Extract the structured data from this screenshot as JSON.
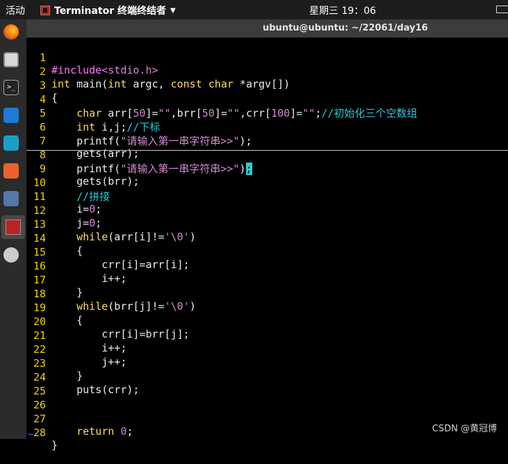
{
  "topbar": {
    "activities": "活动",
    "app_name": "Terminator 终端终结者",
    "clock": "星期三 19：06"
  },
  "window": {
    "title": "ubuntu@ubuntu: ~/22061/day16"
  },
  "dock": {
    "items": [
      "firefox-icon",
      "files-icon",
      "terminal-icon",
      "vscode-icon",
      "vscode-insiders-icon",
      "software-center-icon",
      "network-tool-icon",
      "terminator-icon",
      "update-icon"
    ]
  },
  "editor": {
    "filler": "~",
    "lines": [
      {
        "n": "1"
      },
      {
        "n": "2"
      },
      {
        "n": "3"
      },
      {
        "n": "4"
      },
      {
        "n": "5"
      },
      {
        "n": "6"
      },
      {
        "n": "7"
      },
      {
        "n": "8"
      },
      {
        "n": "9"
      },
      {
        "n": "10"
      },
      {
        "n": "11"
      },
      {
        "n": "12"
      },
      {
        "n": "13"
      },
      {
        "n": "14"
      },
      {
        "n": "15"
      },
      {
        "n": "16"
      },
      {
        "n": "17"
      },
      {
        "n": "18"
      },
      {
        "n": "19"
      },
      {
        "n": "20"
      },
      {
        "n": "21"
      },
      {
        "n": "22"
      },
      {
        "n": "23"
      },
      {
        "n": "24"
      },
      {
        "n": "25"
      },
      {
        "n": "26"
      },
      {
        "n": "27"
      },
      {
        "n": "28"
      }
    ],
    "code": {
      "l1": [
        "#include",
        "<stdio.h>"
      ],
      "l2": [
        "int",
        " main(",
        "int",
        " argc, ",
        "const",
        " ",
        "char",
        " *argv[])"
      ],
      "l3": [
        "{"
      ],
      "l4": [
        "    ",
        "char",
        " arr[",
        "50",
        "]=",
        "\"\"",
        ",brr[",
        "50",
        "]=",
        "\"\"",
        ",crr[",
        "100",
        "]=",
        "\"\"",
        ";",
        "//初始化三个空数组"
      ],
      "l5": [
        "    ",
        "int",
        " i,j;",
        "//下标"
      ],
      "l6": [
        "    printf(",
        "\"请输入第一串字符串>>\"",
        ");"
      ],
      "l7": [
        "    gets(arr);"
      ],
      "l8": [
        "    printf(",
        "\"请输入第一串字符串>>\"",
        ")",
        ";"
      ],
      "l9": [
        "    gets(brr);"
      ],
      "l10": [
        "    ",
        "//拼接"
      ],
      "l11": [
        "    i=",
        "0",
        ";"
      ],
      "l12": [
        "    j=",
        "0",
        ";"
      ],
      "l13": [
        "    ",
        "while",
        "(arr[i]!=",
        "'\\0'",
        ")"
      ],
      "l14": [
        "    {"
      ],
      "l15": [
        "        crr[i]=arr[i];"
      ],
      "l16": [
        "        i++;"
      ],
      "l17": [
        "    }"
      ],
      "l18": [
        "    ",
        "while",
        "(brr[j]!=",
        "'\\0'",
        ")"
      ],
      "l19": [
        "    {"
      ],
      "l20": [
        "        crr[i]=brr[j];"
      ],
      "l21": [
        "        i++;"
      ],
      "l22": [
        "        j++;"
      ],
      "l23": [
        "    }"
      ],
      "l24": [
        "    puts(crr);"
      ],
      "l25": [
        ""
      ],
      "l26": [
        ""
      ],
      "l27": [
        "    ",
        "return",
        " ",
        "0",
        ";"
      ],
      "l28": [
        "}"
      ]
    }
  },
  "watermark": "CSDN @黄冠博",
  "colors": {
    "line_number": "#f0d000",
    "keyword": "#ffd966",
    "string": "#d08ad0",
    "comment": "#29c8d8",
    "cursor": "#2ad0d0"
  }
}
